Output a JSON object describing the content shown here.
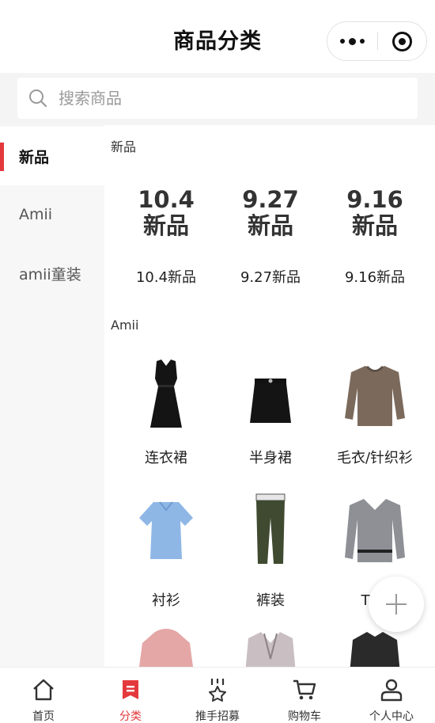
{
  "header": {
    "title": "商品分类"
  },
  "capsule": {
    "more_icon": "more-dots-icon",
    "close_icon": "target-circle-icon"
  },
  "search": {
    "placeholder": "搜索商品",
    "icon": "search-icon"
  },
  "sidebar": {
    "items": [
      {
        "label": "新品",
        "active": true
      },
      {
        "label": "Amii",
        "active": false
      },
      {
        "label": "amii童装",
        "active": false
      }
    ]
  },
  "main": {
    "sections": [
      {
        "title": "新品",
        "items": [
          {
            "image_line1": "10.4",
            "image_line2": "新品",
            "label": "10.4新品"
          },
          {
            "image_line1": "9.27",
            "image_line2": "新品",
            "label": "9.27新品"
          },
          {
            "image_line1": "9.16",
            "image_line2": "新品",
            "label": "9.16新品"
          }
        ]
      },
      {
        "title": "Amii",
        "items": [
          {
            "label": "连衣裙",
            "icon": "dress-icon"
          },
          {
            "label": "半身裙",
            "icon": "skirt-icon"
          },
          {
            "label": "毛衣/针织衫",
            "icon": "sweater-icon"
          },
          {
            "label": "衬衫",
            "icon": "shirt-icon"
          },
          {
            "label": "裤装",
            "icon": "pants-icon"
          },
          {
            "label": "T恤/",
            "icon": "tshirt-icon"
          }
        ]
      }
    ]
  },
  "colors": {
    "accent": "#e4393c",
    "sidebar_bg": "#f7f7f7",
    "search_bg": "#f4f4f4"
  },
  "tabbar": {
    "items": [
      {
        "label": "首页",
        "icon": "home-icon",
        "active": false
      },
      {
        "label": "分类",
        "icon": "category-icon",
        "active": true
      },
      {
        "label": "推手招募",
        "icon": "medal-icon",
        "active": false
      },
      {
        "label": "购物车",
        "icon": "cart-icon",
        "active": false
      },
      {
        "label": "个人中心",
        "icon": "user-icon",
        "active": false
      }
    ]
  }
}
